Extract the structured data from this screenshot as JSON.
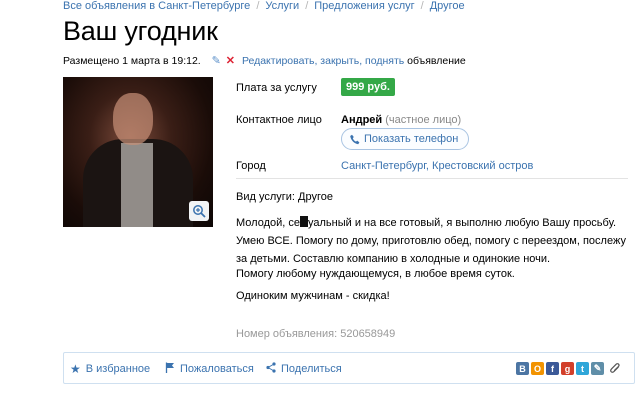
{
  "breadcrumb": {
    "items": [
      "Все объявления в Санкт-Петербурге",
      "Услуги",
      "Предложения услуг",
      "Другое"
    ],
    "separator": "/"
  },
  "ad": {
    "title": "Ваш угодник",
    "posted": "Размещено 1 марта в 19:12.",
    "edit_link": "Редактировать, закрыть, поднять",
    "edit_suffix": " объявление",
    "price_label": "Плата за услугу",
    "price_value": "999 руб.",
    "contact_label": "Контактное лицо",
    "contact_name": "Андрей",
    "contact_type": " (частное лицо)",
    "phone_button": "Показать телефон",
    "city_label": "Город",
    "city_value": "Санкт-Петербург, Крестовский остров",
    "service_type": "Вид услуги: Другое",
    "description_line1_a": "Молодой, се",
    "description_line1_b": "уальный и на все готовый, я выполню любую Вашу просьбу.",
    "description_rest": "Умею ВСЕ. Помогу по дому, приготовлю обед, помогу с переездом, послежу за детьми. Составлю компанию в холодные и одинокие ночи.",
    "paragraph2": "Помогу любому нуждающемуся, в любое время суток.",
    "paragraph3": "Одиноким мужчинам - скидка!",
    "ad_number": "Номер объявления: 520658949"
  },
  "bottom_bar": {
    "favorite": "В избранное",
    "complain": "Пожаловаться",
    "share": "Поделиться",
    "social_icons": [
      "vk-icon",
      "odnoklassniki-icon",
      "facebook-icon",
      "google-plus-icon",
      "twitter-icon",
      "livejournal-icon",
      "attachment-icon"
    ],
    "social_letters": [
      "В",
      "О",
      "f",
      "g",
      "t",
      "✎"
    ]
  },
  "colors": {
    "link": "#3b73af",
    "price_badge": "#34a847",
    "censor": "#111111"
  }
}
